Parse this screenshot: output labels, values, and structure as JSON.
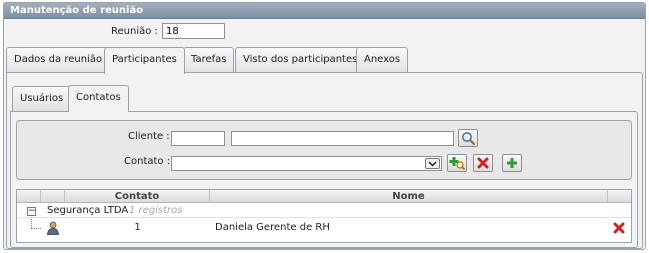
{
  "window": {
    "title": "Manutenção de reunião"
  },
  "meeting": {
    "label": "Reunião :",
    "value": "18"
  },
  "tabs": [
    {
      "label": "Dados da reunião",
      "active": false
    },
    {
      "label": "Participantes",
      "active": true
    },
    {
      "label": "Tarefas",
      "active": false
    },
    {
      "label": "Visto dos participantes",
      "active": false
    },
    {
      "label": "Anexos",
      "active": false
    }
  ],
  "subtabs": [
    {
      "label": "Usuários",
      "active": false
    },
    {
      "label": "Contatos",
      "active": true
    }
  ],
  "filters": {
    "cliente": {
      "label": "Cliente :",
      "code": "",
      "name": ""
    },
    "contato": {
      "label": "Contato :",
      "selected": ""
    }
  },
  "grid": {
    "columns": [
      "Contato",
      "Nome"
    ],
    "group": {
      "name": "Segurança LTDA",
      "count_text": "1 registros"
    },
    "rows": [
      {
        "contato": "1",
        "nome": "Daniela Gerente de RH"
      }
    ]
  },
  "colors": {
    "titlebar": "#8b98ab",
    "border": "#9aa3ad",
    "delete": "#d42020",
    "add": "#2f9a2f"
  },
  "icons": {
    "search": "magnifier-icon",
    "add_search": "add-search-icon",
    "delete": "delete-icon",
    "add": "plus-icon",
    "person": "person-icon",
    "expander": "collapse-icon"
  }
}
